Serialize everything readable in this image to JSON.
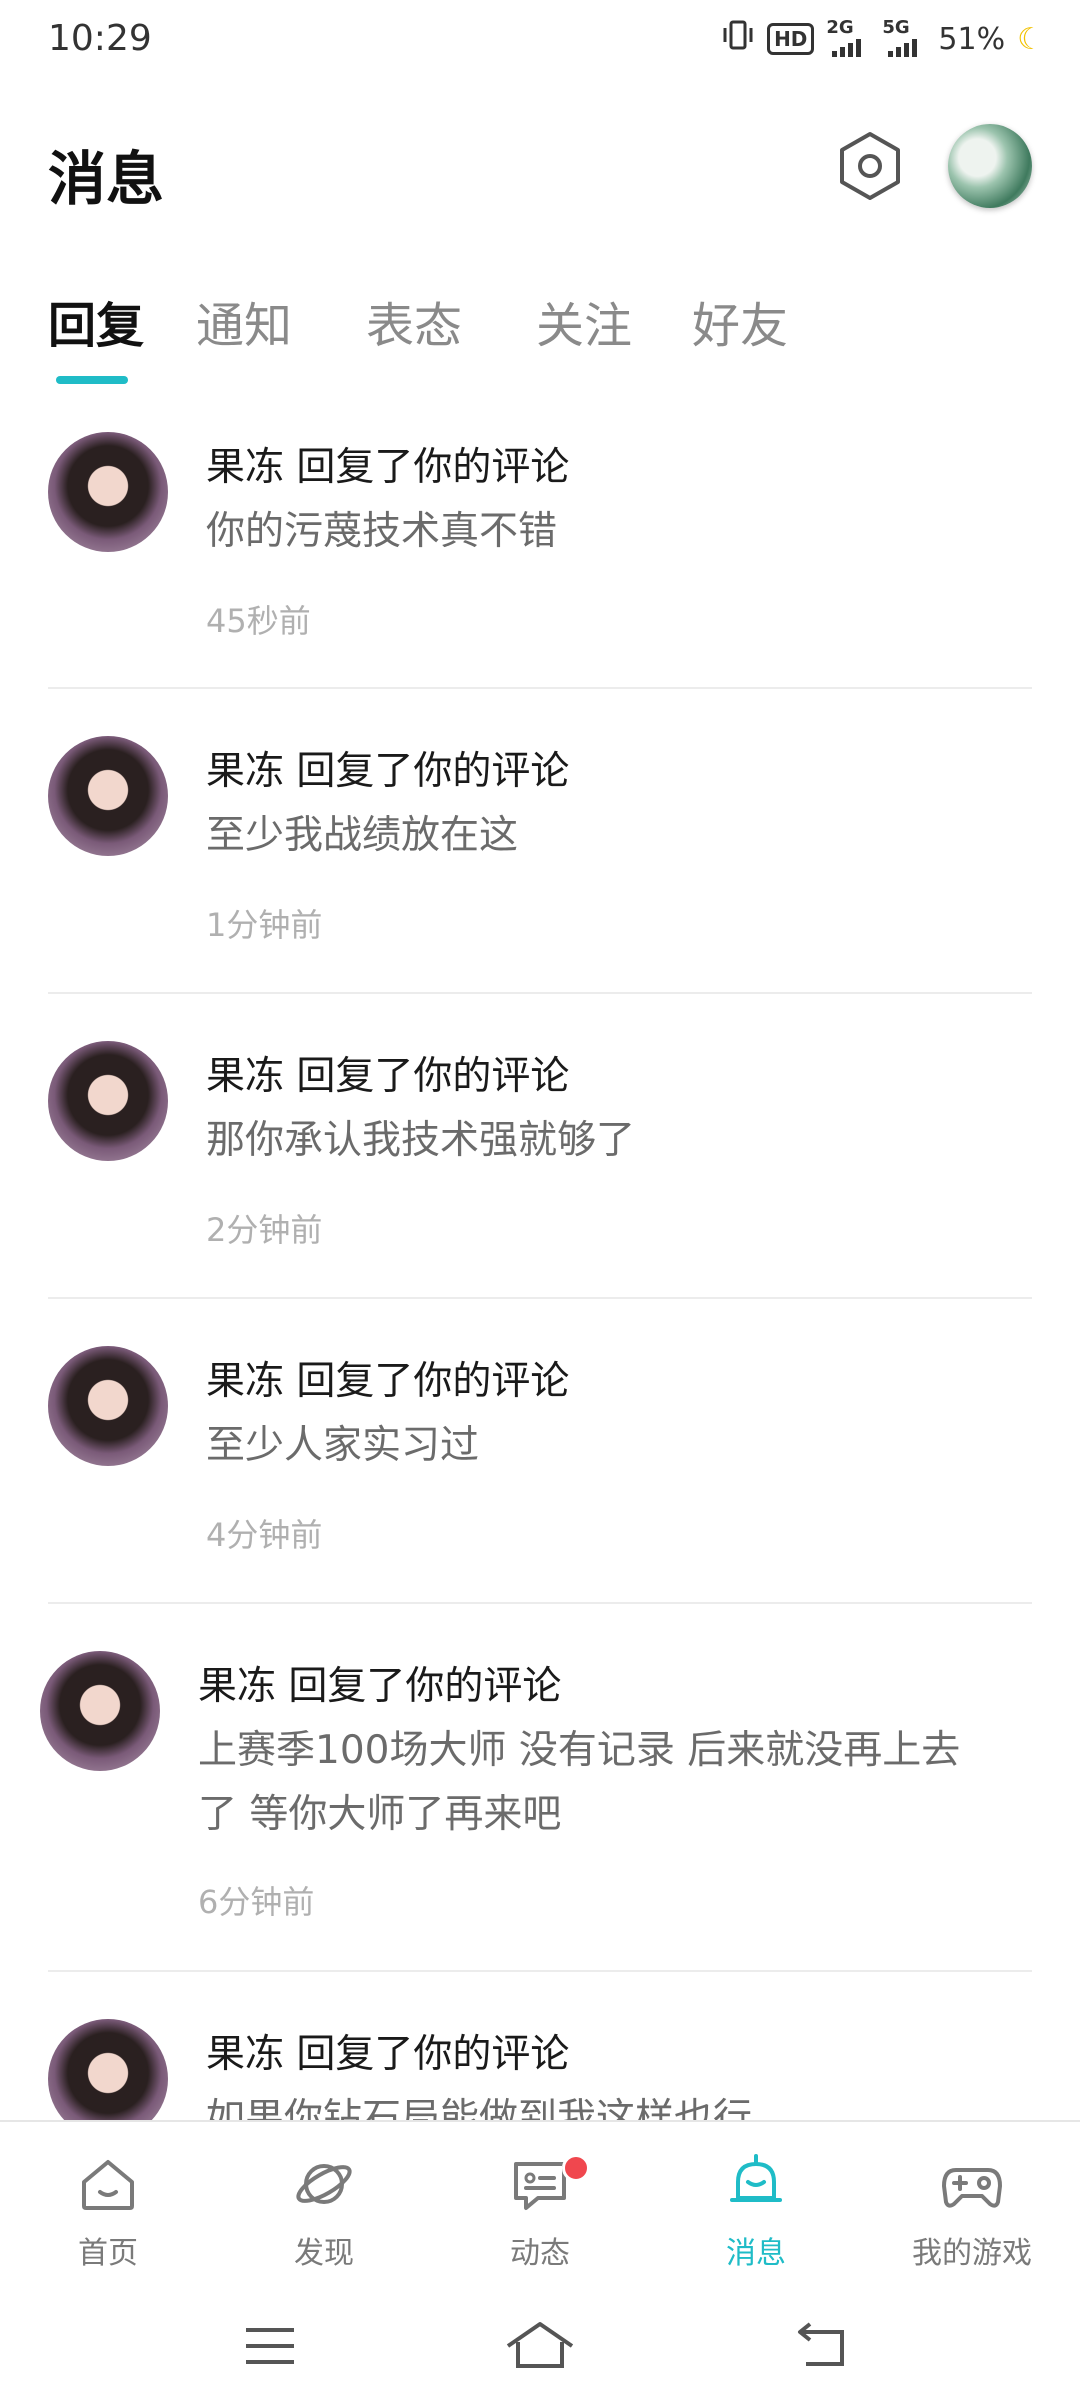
{
  "status_bar": {
    "time": "10:29",
    "hd": "HD",
    "net1": "2G",
    "net2": "5G",
    "battery": "51%"
  },
  "header": {
    "title": "消息"
  },
  "tabs": [
    {
      "label": "回复",
      "active": true
    },
    {
      "label": "通知"
    },
    {
      "label": "表态"
    },
    {
      "label": "关注"
    },
    {
      "label": "好友"
    }
  ],
  "messages": [
    {
      "name": "果冻 回复了你的评论",
      "content": "你的污蔑技术真不错",
      "time": "45秒前"
    },
    {
      "name": "果冻 回复了你的评论",
      "content": "至少我战绩放在这",
      "time": "1分钟前"
    },
    {
      "name": "果冻 回复了你的评论",
      "content": "那你承认我技术强就够了",
      "time": "2分钟前"
    },
    {
      "name": "果冻 回复了你的评论",
      "content": "至少人家实习过",
      "time": "4分钟前"
    },
    {
      "name": "果冻 回复了你的评论",
      "content_line1": "上赛季100场大师  没有记录 后来就没再上去",
      "content_line2": "了 等你大师了再来吧",
      "time": "6分钟前"
    },
    {
      "name": "果冻 回复了你的评论",
      "content": "如果你钻石局能做到我这样也行"
    }
  ],
  "bottom_nav": [
    {
      "label": "首页",
      "icon": "home-icon"
    },
    {
      "label": "发现",
      "icon": "planet-icon"
    },
    {
      "label": "动态",
      "icon": "chat-icon"
    },
    {
      "label": "消息",
      "icon": "bell-icon",
      "active": true
    },
    {
      "label": "我的游戏",
      "icon": "gamepad-icon"
    }
  ],
  "colors": {
    "accent": "#1fbcc7",
    "badge": "#f0474e"
  }
}
